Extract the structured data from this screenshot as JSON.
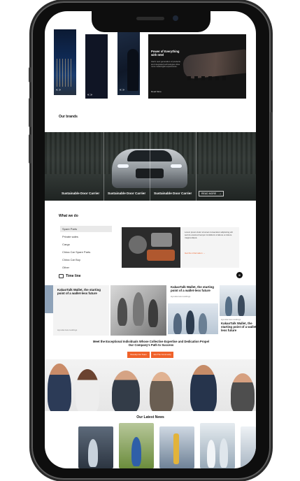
{
  "top_slides": {
    "arrows": "« »",
    "feature": {
      "eyebrow": "",
      "title": "Power of Everything with Intel",
      "body": "Intel's next generation of products and integrated technologies drive more meaningful experiences.",
      "link": "Read More"
    }
  },
  "brands": {
    "heading": "Our brands",
    "captions": [
      "Sustainable Door Carrier",
      "Sustainable Door Carrier",
      "Sustainable Door Carrier"
    ],
    "read_more": "READ MORE",
    "arrow": "→"
  },
  "what_we_do": {
    "heading": "What we do",
    "items": [
      "Spare Parts",
      "Private sales",
      "Cargo",
      "China Car Spare Parts",
      "China Car Buy",
      "Other"
    ],
    "description": "Lorem ipsum dolor sit amet consectetur adipiscing elit sed do eiusmod tempor incididunt ut labore et dolore magna aliqua.",
    "link": "Get the information →"
  },
  "timeline": {
    "icon_label": "Time line",
    "pause": "II",
    "cards": [
      {
        "title": "KakaoTalk Wallet, the starting point of a wallet-less future",
        "meta": "Hyundai Auto Holdings"
      },
      {
        "title": "KakaoTalk Wallet, the starting point of a wallet-less future",
        "meta": "Hyundai Auto Holdings"
      },
      {
        "title": "KakaoTalk Wallet, the starting point of a wallet-less future",
        "meta": "Hyundai Auto Holdings"
      }
    ]
  },
  "team": {
    "heading": "Meet the Exceptional Individuals Whose Collective Expertise and Dedication Propel Our Company's Path to Success",
    "btn1": "Develop Our Team",
    "btn2": "Join The Community"
  },
  "news": {
    "heading": "Our Latest News"
  },
  "colors": {
    "accent": "#f0622a",
    "phone": "#0e0e0e",
    "dark": "#1b1f2a"
  }
}
